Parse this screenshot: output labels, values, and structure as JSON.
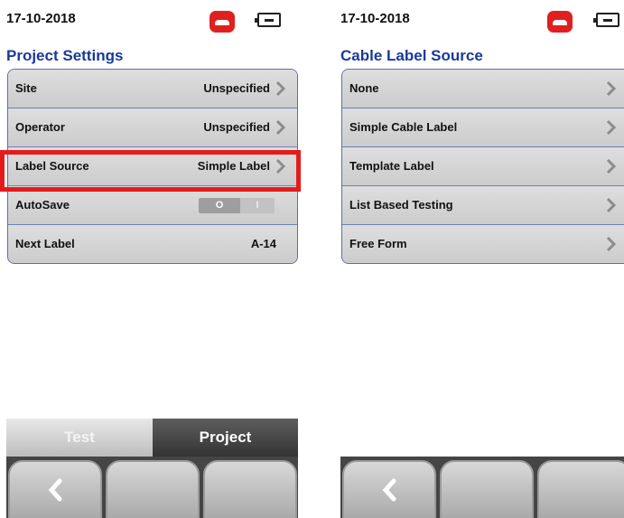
{
  "left_screen": {
    "status": {
      "date": "17-10-2018",
      "call_icon": "phone-hangup-icon",
      "battery_icon": "battery-plug-icon"
    },
    "title": "Project Settings",
    "rows": [
      {
        "label": "Site",
        "value": "Unspecified",
        "has_chevron": true
      },
      {
        "label": "Operator",
        "value": "Unspecified",
        "has_chevron": true
      },
      {
        "label": "Label Source",
        "value": "Simple Label",
        "has_chevron": true,
        "highlighted": true
      },
      {
        "label": "AutoSave",
        "toggle": {
          "off_label": "O",
          "on_label": "I",
          "state": "off"
        }
      },
      {
        "label": "Next Label",
        "value": "A-14",
        "has_chevron": false
      }
    ],
    "tabs": {
      "test": "Test",
      "project": "Project",
      "active": "Project"
    },
    "highlight_color": "#e51b1b"
  },
  "right_screen": {
    "status": {
      "date": "17-10-2018",
      "call_icon": "phone-hangup-icon",
      "battery_icon": "battery-plug-icon"
    },
    "title": "Cable Label Source",
    "options": [
      {
        "label": "None"
      },
      {
        "label": "Simple Cable Label"
      },
      {
        "label": "Template Label"
      },
      {
        "label": "List Based Testing"
      },
      {
        "label": "Free Form"
      }
    ]
  },
  "softkeys": {
    "back_icon": "back-chevron-icon"
  },
  "colors": {
    "title": "#1a3a9a",
    "accent_red": "#e02020",
    "panel_border": "#5d6fa8"
  }
}
